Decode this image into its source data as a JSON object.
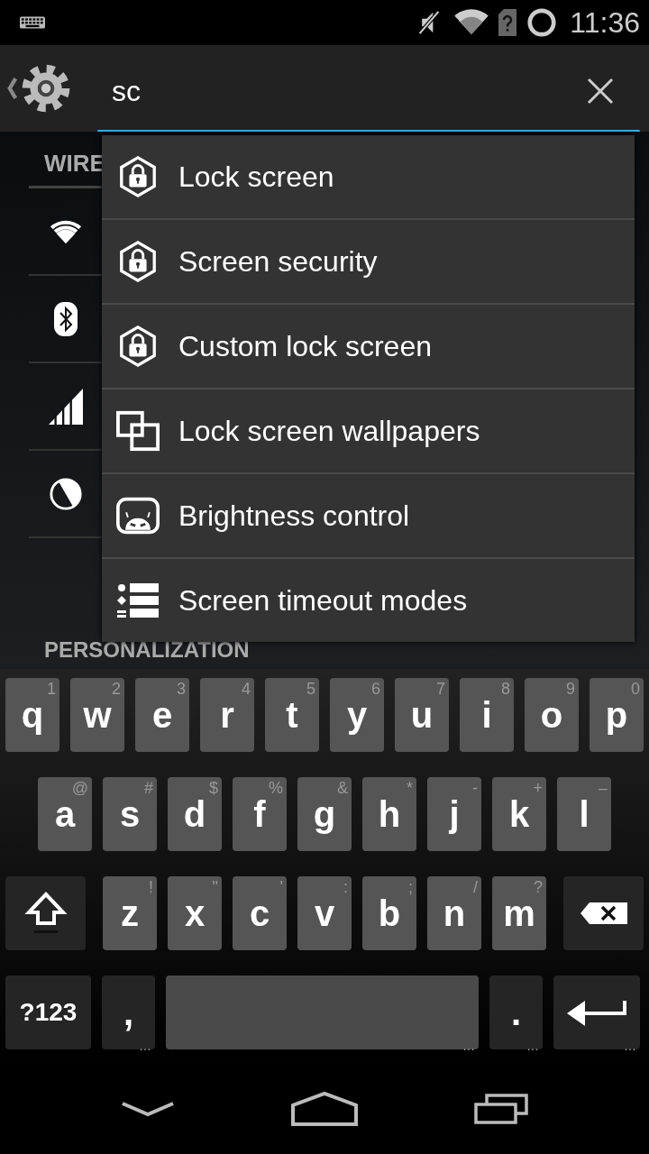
{
  "status_bar": {
    "time": "11:36"
  },
  "search": {
    "value": "sc"
  },
  "settings": {
    "section_1": "WIRE",
    "section_2": "PERSONALIZATION"
  },
  "suggestions": [
    {
      "label": "Lock screen"
    },
    {
      "label": "Screen security"
    },
    {
      "label": "Custom lock screen"
    },
    {
      "label": "Lock screen wallpapers"
    },
    {
      "label": "Brightness control"
    },
    {
      "label": "Screen timeout modes"
    }
  ],
  "keyboard": {
    "rows": [
      {
        "keys": [
          {
            "kind": "letter",
            "label": "q",
            "hint": "1"
          },
          {
            "kind": "letter",
            "label": "w",
            "hint": "2"
          },
          {
            "kind": "letter",
            "label": "e",
            "hint": "3"
          },
          {
            "kind": "letter",
            "label": "r",
            "hint": "4"
          },
          {
            "kind": "letter",
            "label": "t",
            "hint": "5"
          },
          {
            "kind": "letter",
            "label": "y",
            "hint": "6"
          },
          {
            "kind": "letter",
            "label": "u",
            "hint": "7"
          },
          {
            "kind": "letter",
            "label": "i",
            "hint": "8"
          },
          {
            "kind": "letter",
            "label": "o",
            "hint": "9"
          },
          {
            "kind": "letter",
            "label": "p",
            "hint": "0"
          }
        ]
      },
      {
        "keys": [
          {
            "kind": "letter",
            "label": "a",
            "hint": "@"
          },
          {
            "kind": "letter",
            "label": "s",
            "hint": "#"
          },
          {
            "kind": "letter",
            "label": "d",
            "hint": "$"
          },
          {
            "kind": "letter",
            "label": "f",
            "hint": "%"
          },
          {
            "kind": "letter",
            "label": "g",
            "hint": "&"
          },
          {
            "kind": "letter",
            "label": "h",
            "hint": "*"
          },
          {
            "kind": "letter",
            "label": "j",
            "hint": "-"
          },
          {
            "kind": "letter",
            "label": "k",
            "hint": "+"
          },
          {
            "kind": "letter",
            "label": "l",
            "hint": "–"
          }
        ]
      },
      {
        "keys": [
          {
            "kind": "shift"
          },
          {
            "kind": "letter",
            "label": "z",
            "hint": "!"
          },
          {
            "kind": "letter",
            "label": "x",
            "hint": "\""
          },
          {
            "kind": "letter",
            "label": "c",
            "hint": "'"
          },
          {
            "kind": "letter",
            "label": "v",
            "hint": ":"
          },
          {
            "kind": "letter",
            "label": "b",
            "hint": ";"
          },
          {
            "kind": "letter",
            "label": "n",
            "hint": "/"
          },
          {
            "kind": "letter",
            "label": "m",
            "hint": "?"
          },
          {
            "kind": "backspace"
          }
        ]
      },
      {
        "keys": [
          {
            "kind": "symbols",
            "label": "?123"
          },
          {
            "kind": "comma",
            "label": ",",
            "hint": "…"
          },
          {
            "kind": "space",
            "hint": "…"
          },
          {
            "kind": "period",
            "label": ".",
            "hint": "…"
          },
          {
            "kind": "enter",
            "hint": "…"
          }
        ]
      }
    ]
  }
}
